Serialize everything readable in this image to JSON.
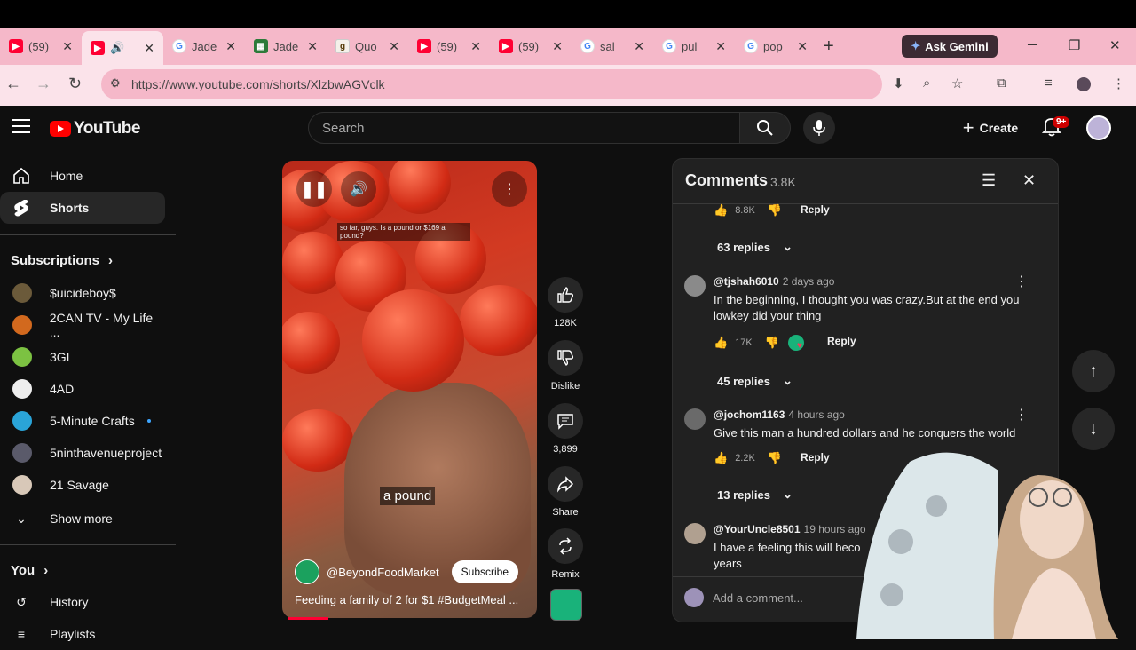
{
  "browser": {
    "tabs": [
      {
        "title": "(59)",
        "icon": "youtube-icon"
      },
      {
        "title": "",
        "icon": "youtube-icon",
        "active": true,
        "audio": true
      },
      {
        "title": "Jade",
        "icon": "google-icon"
      },
      {
        "title": "Jade",
        "icon": "site-icon"
      },
      {
        "title": "Quo",
        "icon": "goodreads-icon"
      },
      {
        "title": "(59)",
        "icon": "youtube-icon"
      },
      {
        "title": "(59)",
        "icon": "youtube-icon"
      },
      {
        "title": "sal",
        "icon": "google-icon"
      },
      {
        "title": "pul",
        "icon": "google-icon"
      },
      {
        "title": "pop",
        "icon": "google-icon"
      }
    ],
    "new_tab": "+",
    "gemini": "Ask Gemini",
    "url": "https://www.youtube.com/shorts/XlzbwAGVclk"
  },
  "header": {
    "logo": "YouTube",
    "search_placeholder": "Search",
    "create": "Create",
    "notifications": "9+"
  },
  "sidebar": {
    "home": "Home",
    "shorts": "Shorts",
    "subscriptions_title": "Subscriptions",
    "subs": [
      {
        "name": "$uicideboy$",
        "color": "#6b5a3a"
      },
      {
        "name": "2CAN TV - My Life ...",
        "color": "#d2691e"
      },
      {
        "name": "3GI",
        "color": "#7cc242"
      },
      {
        "name": "4AD",
        "color": "#eeeeee"
      },
      {
        "name": "5-Minute Crafts",
        "color": "#2aa4d8"
      },
      {
        "name": "5ninthavenueproject",
        "color": "#5a5a6a"
      },
      {
        "name": "21 Savage",
        "color": "#d8c8b8"
      }
    ],
    "show_more": "Show more",
    "you_title": "You",
    "history": "History",
    "playlists": "Playlists"
  },
  "video": {
    "caption_top": "so far, guys. Is a pound or $169 a pound?",
    "caption_mid": "a pound",
    "channel": "@BeyondFoodMarket",
    "subscribe": "Subscribe",
    "title": "Feeding a family of 2 for $1 #BudgetMeal ...",
    "progress": 0.16
  },
  "actions": {
    "likes": "128K",
    "dislike": "Dislike",
    "comments": "3,899",
    "share": "Share",
    "remix": "Remix"
  },
  "comments_panel": {
    "title": "Comments",
    "count": "3.8K",
    "top_like": "8.8K",
    "reply": "Reply",
    "replies_1": "63 replies",
    "c1_user": "@tjshah6010",
    "c1_time": "2 days ago",
    "c1_text": "In the beginning, I thought you was crazy.But at the end you lowkey did your thing",
    "c1_likes": "17K",
    "replies_2": "45 replies",
    "c2_user": "@jochom1163",
    "c2_time": "4 hours ago",
    "c2_text": "Give this man a hundred dollars and he conquers the world",
    "c2_likes": "2.2K",
    "replies_3": "13 replies",
    "c3_user": "@YourUncle8501",
    "c3_time": "19 hours ago",
    "c3_text": "I have a feeling this will beco",
    "c3_text2": "years",
    "add_comment": "Add a comment..."
  }
}
